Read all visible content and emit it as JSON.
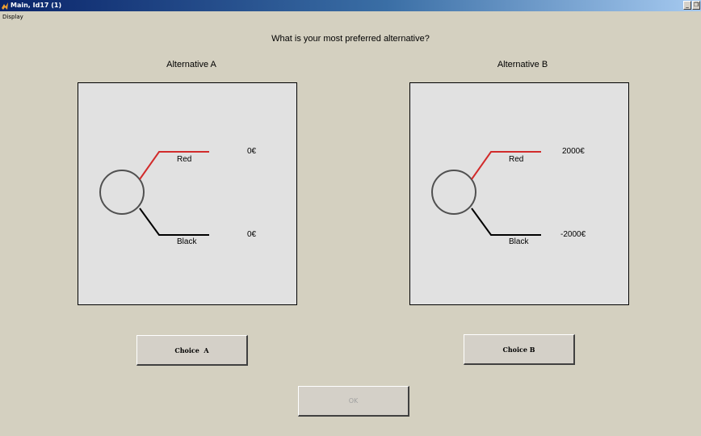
{
  "window": {
    "title": "Main, Id17 (1)",
    "controls": {
      "minimize": "_",
      "restore": "❐"
    }
  },
  "menu": {
    "items": [
      "Display"
    ]
  },
  "question": "What is your most preferred alternative?",
  "alternatives": [
    {
      "title": "Alternative A",
      "branches": [
        {
          "label": "Red",
          "outcome": "0€",
          "color": "#d12b2b"
        },
        {
          "label": "Black",
          "outcome": "0€",
          "color": "#000000"
        }
      ],
      "button_label": "Choice  A"
    },
    {
      "title": "Alternative B",
      "branches": [
        {
          "label": "Red",
          "outcome": "2000€",
          "color": "#d12b2b"
        },
        {
          "label": "Black",
          "outcome": "-2000€",
          "color": "#000000"
        }
      ],
      "button_label": "Choice B"
    }
  ],
  "ok_button": {
    "label": "OK",
    "enabled": false
  },
  "colors": {
    "background": "#d4d0c0",
    "panel": "#e1e1e1",
    "red_branch": "#d12b2b",
    "black_branch": "#000000",
    "circle": "#505050"
  }
}
